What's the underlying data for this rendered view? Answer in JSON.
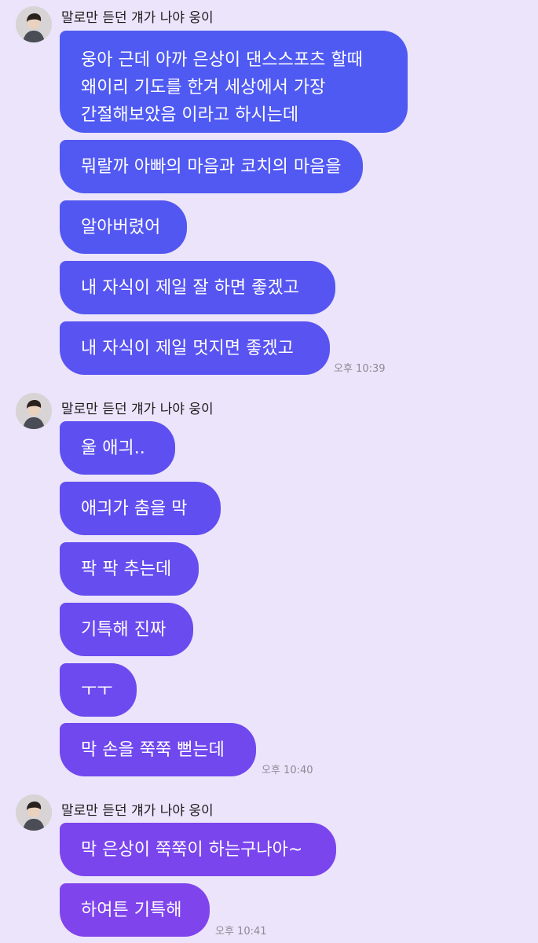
{
  "sender_name": "말로만 듣던 걔가 나야 웅이",
  "icons": {
    "avatar": "profile-photo-icon"
  },
  "colors": {
    "background": "#ECE4FA",
    "bubble_start": "#4A5CF2",
    "bubble_end": "#8A44EC",
    "text": "#FFFFFF",
    "timestamp": "#8E8A96"
  },
  "groups": [
    {
      "messages": [
        {
          "lines": [
            "웅아 근데 아까 은상이 댄스스포츠 할때",
            "왜이리 기도를 한겨 세상에서 가장",
            "간절해보았음 이라고 하시는데"
          ]
        },
        {
          "text": "뭐랄까 아빠의 마음과 코치의 마음을"
        },
        {
          "text": "알아버렸어"
        },
        {
          "text": "내 자식이 제일 잘 하면 좋겠고"
        },
        {
          "text": "내 자식이 제일 멋지면 좋겠고"
        }
      ],
      "time": "오후 10:39"
    },
    {
      "messages": [
        {
          "text": "울 애긔.."
        },
        {
          "text": "애긔가 춤을 막"
        },
        {
          "text": "팍 팍 추는데"
        },
        {
          "text": "기특해 진짜"
        },
        {
          "text": "ㅜㅜ"
        },
        {
          "text": "막 손을 쭉쭉 뻗는데"
        }
      ],
      "time": "오후 10:40"
    },
    {
      "messages": [
        {
          "text": "막 은상이 쭉쭉이 하는구나아~"
        },
        {
          "text": "하여튼 기특해"
        }
      ],
      "time": "오후 10:41"
    }
  ]
}
